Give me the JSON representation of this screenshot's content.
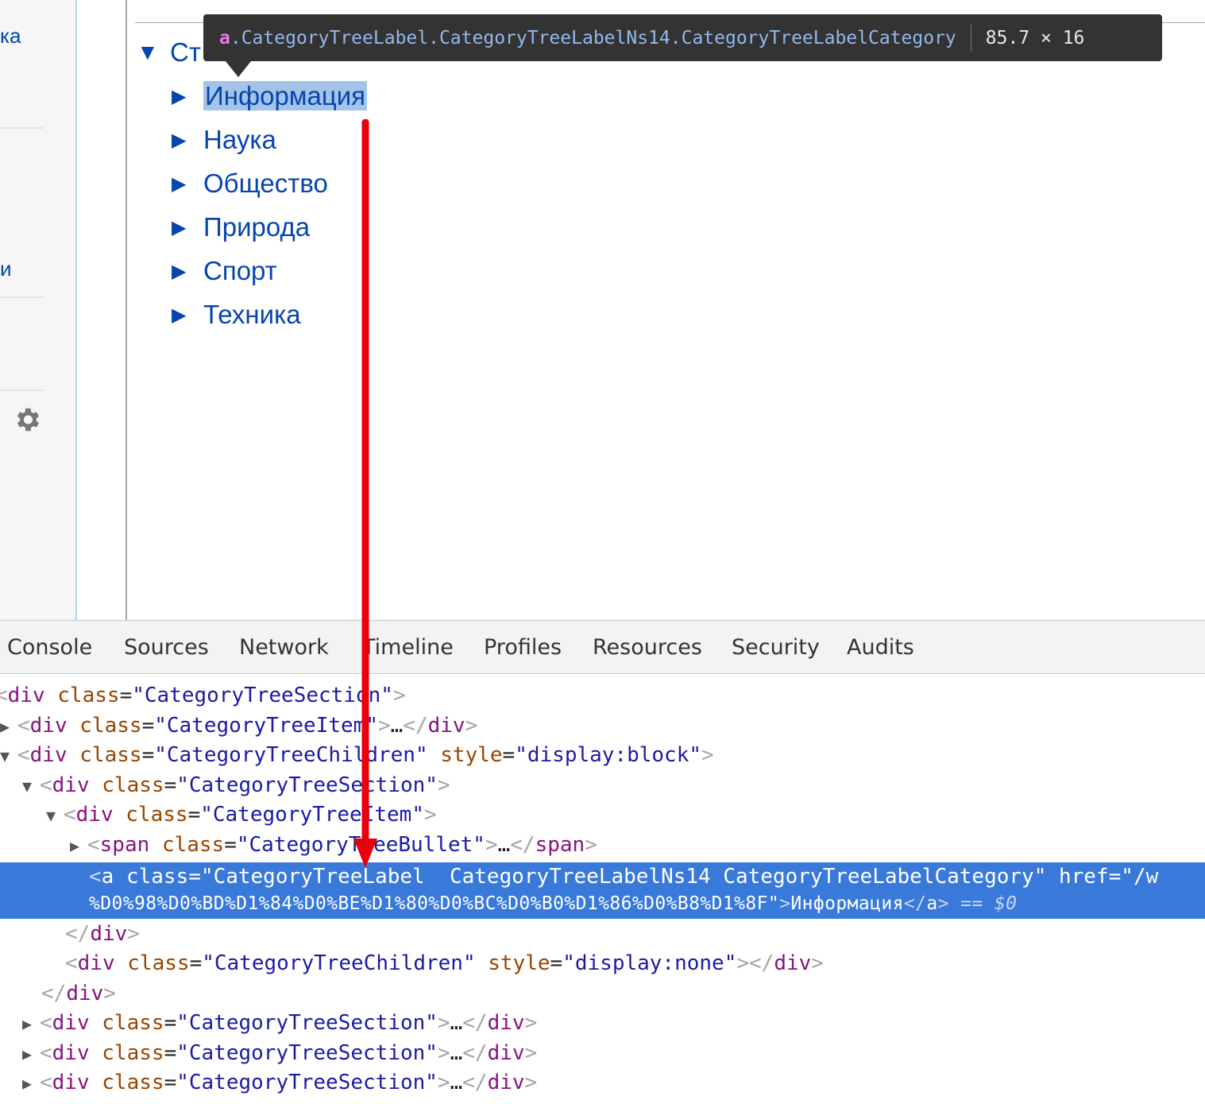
{
  "page": {
    "sidebar": {
      "partial_items": [
        "ка",
        "и"
      ],
      "settings_icon": "gear-icon"
    },
    "tree": {
      "root_label": "Ст",
      "items": [
        {
          "label": "Информация"
        },
        {
          "label": "Наука"
        },
        {
          "label": "Общество"
        },
        {
          "label": "Природа"
        },
        {
          "label": "Спорт"
        },
        {
          "label": "Техника"
        }
      ]
    },
    "tooltip": {
      "tag": "a",
      "classes": ".CategoryTreeLabel.CategoryTreeLabelNs14.CategoryTreeLabelCategory",
      "dimensions": "85.7 × 16"
    }
  },
  "devtools": {
    "tabs": [
      "Console",
      "Sources",
      "Network",
      "Timeline",
      "Profiles",
      "Resources",
      "Security",
      "Audits"
    ],
    "elements": {
      "line1": {
        "tag": "div",
        "attr": "class",
        "val": "CategoryTreeSection"
      },
      "line2": {
        "tag": "div",
        "attr": "class",
        "val": "CategoryTreeItem",
        "ellipsis": "…"
      },
      "line3": {
        "tag": "div",
        "attr": "class",
        "val": "CategoryTreeChildren",
        "attr2": "style",
        "val2": "display:block"
      },
      "line4": {
        "tag": "div",
        "attr": "class",
        "val": "CategoryTreeSection"
      },
      "line5": {
        "tag": "div",
        "attr": "class",
        "val": "CategoryTreeItem"
      },
      "line6": {
        "tag": "span",
        "attr": "class",
        "val": "CategoryTreeBullet",
        "ellipsis": "…"
      },
      "selected": {
        "tag": "a",
        "attr": "class",
        "val": "CategoryTreeLabel  CategoryTreeLabelNs14 CategoryTreeLabelCategory",
        "attr2": "href",
        "val2_start": "/w",
        "val2_cont": "%D0%98%D0%BD%D1%84%D0%BE%D1%80%D0%BC%D0%B0%D1%86%D0%B8%D1%8F",
        "text": "Информация",
        "dollar": "== $0"
      },
      "line9": {
        "tag": "div"
      },
      "line10": {
        "tag": "div",
        "attr": "class",
        "val": "CategoryTreeChildren",
        "attr2": "style",
        "val2": "display:none"
      },
      "line11": {
        "tag": "div"
      },
      "sections": [
        {
          "tag": "div",
          "attr": "class",
          "val": "CategoryTreeSection",
          "ellipsis": "…"
        },
        {
          "tag": "div",
          "attr": "class",
          "val": "CategoryTreeSection",
          "ellipsis": "…"
        },
        {
          "tag": "div",
          "attr": "class",
          "val": "CategoryTreeSection",
          "ellipsis": "…"
        }
      ]
    }
  },
  "colors": {
    "link": "#0645ad",
    "selection": "#3879d9",
    "annotation_arrow": "#e8000b"
  }
}
